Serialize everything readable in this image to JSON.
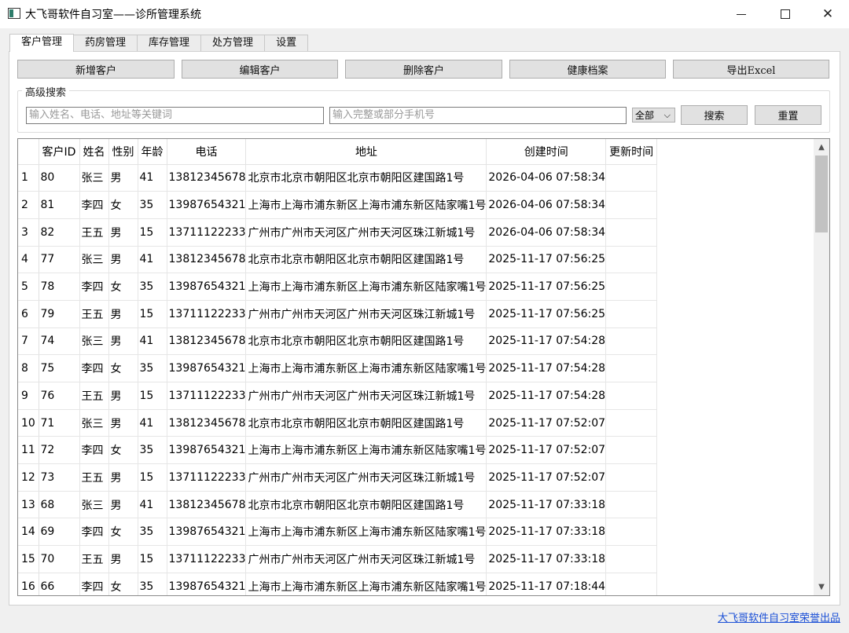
{
  "window": {
    "title": "大飞哥软件自习室——诊所管理系统"
  },
  "tabs": [
    "客户管理",
    "药房管理",
    "库存管理",
    "处方管理",
    "设置"
  ],
  "toolbar": {
    "add": "新增客户",
    "edit": "编辑客户",
    "delete": "删除客户",
    "health": "健康档案",
    "export": "导出Excel"
  },
  "search": {
    "group_title": "高级搜索",
    "keyword_placeholder": "输入姓名、电话、地址等关键词",
    "phone_placeholder": "输入完整或部分手机号",
    "filter_value": "全部",
    "search_button": "搜索",
    "reset_button": "重置"
  },
  "table": {
    "columns": [
      "客户ID",
      "姓名",
      "性别",
      "年龄",
      "电话",
      "地址",
      "创建时间",
      "更新时间"
    ],
    "rows": [
      [
        "1",
        "80",
        "张三",
        "男",
        "41",
        "13812345678",
        "北京市北京市朝阳区北京市朝阳区建国路1号",
        "2026-04-06 07:58:34",
        ""
      ],
      [
        "2",
        "81",
        "李四",
        "女",
        "35",
        "13987654321",
        "上海市上海市浦东新区上海市浦东新区陆家嘴1号",
        "2026-04-06 07:58:34",
        ""
      ],
      [
        "3",
        "82",
        "王五",
        "男",
        "15",
        "13711122233",
        "广州市广州市天河区广州市天河区珠江新城1号",
        "2026-04-06 07:58:34",
        ""
      ],
      [
        "4",
        "77",
        "张三",
        "男",
        "41",
        "13812345678",
        "北京市北京市朝阳区北京市朝阳区建国路1号",
        "2025-11-17 07:56:25",
        ""
      ],
      [
        "5",
        "78",
        "李四",
        "女",
        "35",
        "13987654321",
        "上海市上海市浦东新区上海市浦东新区陆家嘴1号",
        "2025-11-17 07:56:25",
        ""
      ],
      [
        "6",
        "79",
        "王五",
        "男",
        "15",
        "13711122233",
        "广州市广州市天河区广州市天河区珠江新城1号",
        "2025-11-17 07:56:25",
        ""
      ],
      [
        "7",
        "74",
        "张三",
        "男",
        "41",
        "13812345678",
        "北京市北京市朝阳区北京市朝阳区建国路1号",
        "2025-11-17 07:54:28",
        ""
      ],
      [
        "8",
        "75",
        "李四",
        "女",
        "35",
        "13987654321",
        "上海市上海市浦东新区上海市浦东新区陆家嘴1号",
        "2025-11-17 07:54:28",
        ""
      ],
      [
        "9",
        "76",
        "王五",
        "男",
        "15",
        "13711122233",
        "广州市广州市天河区广州市天河区珠江新城1号",
        "2025-11-17 07:54:28",
        ""
      ],
      [
        "10",
        "71",
        "张三",
        "男",
        "41",
        "13812345678",
        "北京市北京市朝阳区北京市朝阳区建国路1号",
        "2025-11-17 07:52:07",
        ""
      ],
      [
        "11",
        "72",
        "李四",
        "女",
        "35",
        "13987654321",
        "上海市上海市浦东新区上海市浦东新区陆家嘴1号",
        "2025-11-17 07:52:07",
        ""
      ],
      [
        "12",
        "73",
        "王五",
        "男",
        "15",
        "13711122233",
        "广州市广州市天河区广州市天河区珠江新城1号",
        "2025-11-17 07:52:07",
        ""
      ],
      [
        "13",
        "68",
        "张三",
        "男",
        "41",
        "13812345678",
        "北京市北京市朝阳区北京市朝阳区建国路1号",
        "2025-11-17 07:33:18",
        ""
      ],
      [
        "14",
        "69",
        "李四",
        "女",
        "35",
        "13987654321",
        "上海市上海市浦东新区上海市浦东新区陆家嘴1号",
        "2025-11-17 07:33:18",
        ""
      ],
      [
        "15",
        "70",
        "王五",
        "男",
        "15",
        "13711122233",
        "广州市广州市天河区广州市天河区珠江新城1号",
        "2025-11-17 07:33:18",
        ""
      ],
      [
        "16",
        "66",
        "李四",
        "女",
        "35",
        "13987654321",
        "上海市上海市浦东新区上海市浦东新区陆家嘴1号",
        "2025-11-17 07:18:44",
        ""
      ]
    ]
  },
  "footer": {
    "credit": "大飞哥软件自习室荣誉出品"
  }
}
